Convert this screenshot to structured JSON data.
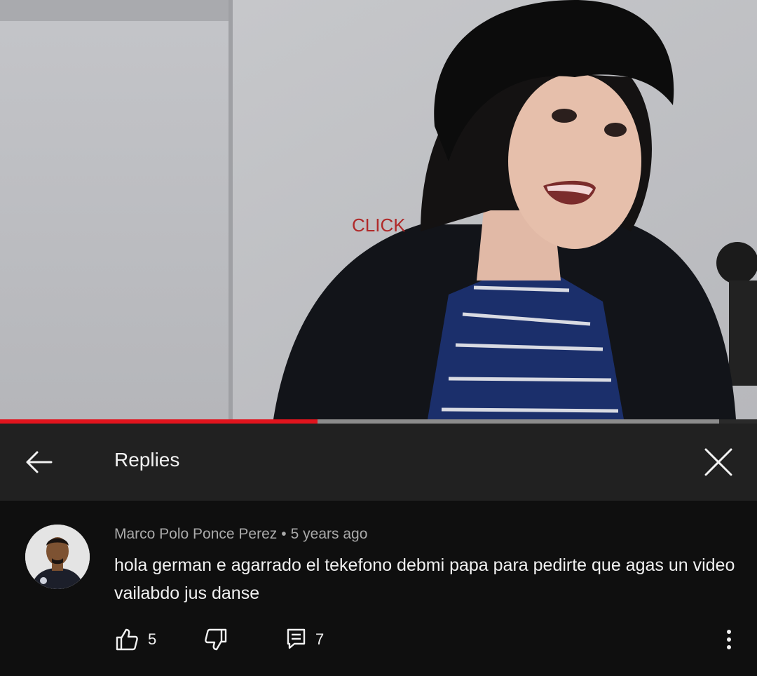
{
  "video": {
    "progress_played": 0.419,
    "progress_buffered": 0.95
  },
  "header": {
    "title": "Replies",
    "back_icon": "arrow-left-icon",
    "close_icon": "close-icon"
  },
  "comment": {
    "author": "Marco Polo Ponce Perez",
    "separator": "•",
    "time": "5 years ago",
    "text": "hola german e agarrado el tekefono debmi papa para pedirte que agas un video vailabdo jus danse",
    "likes": "5",
    "replies": "7",
    "like_icon": "thumb-up-icon",
    "dislike_icon": "thumb-down-icon",
    "reply_icon": "comment-icon",
    "more_icon": "more-vertical-icon"
  },
  "colors": {
    "progress": "#e1141d",
    "header_bg": "#212121",
    "page_bg": "#0f0f0f"
  }
}
